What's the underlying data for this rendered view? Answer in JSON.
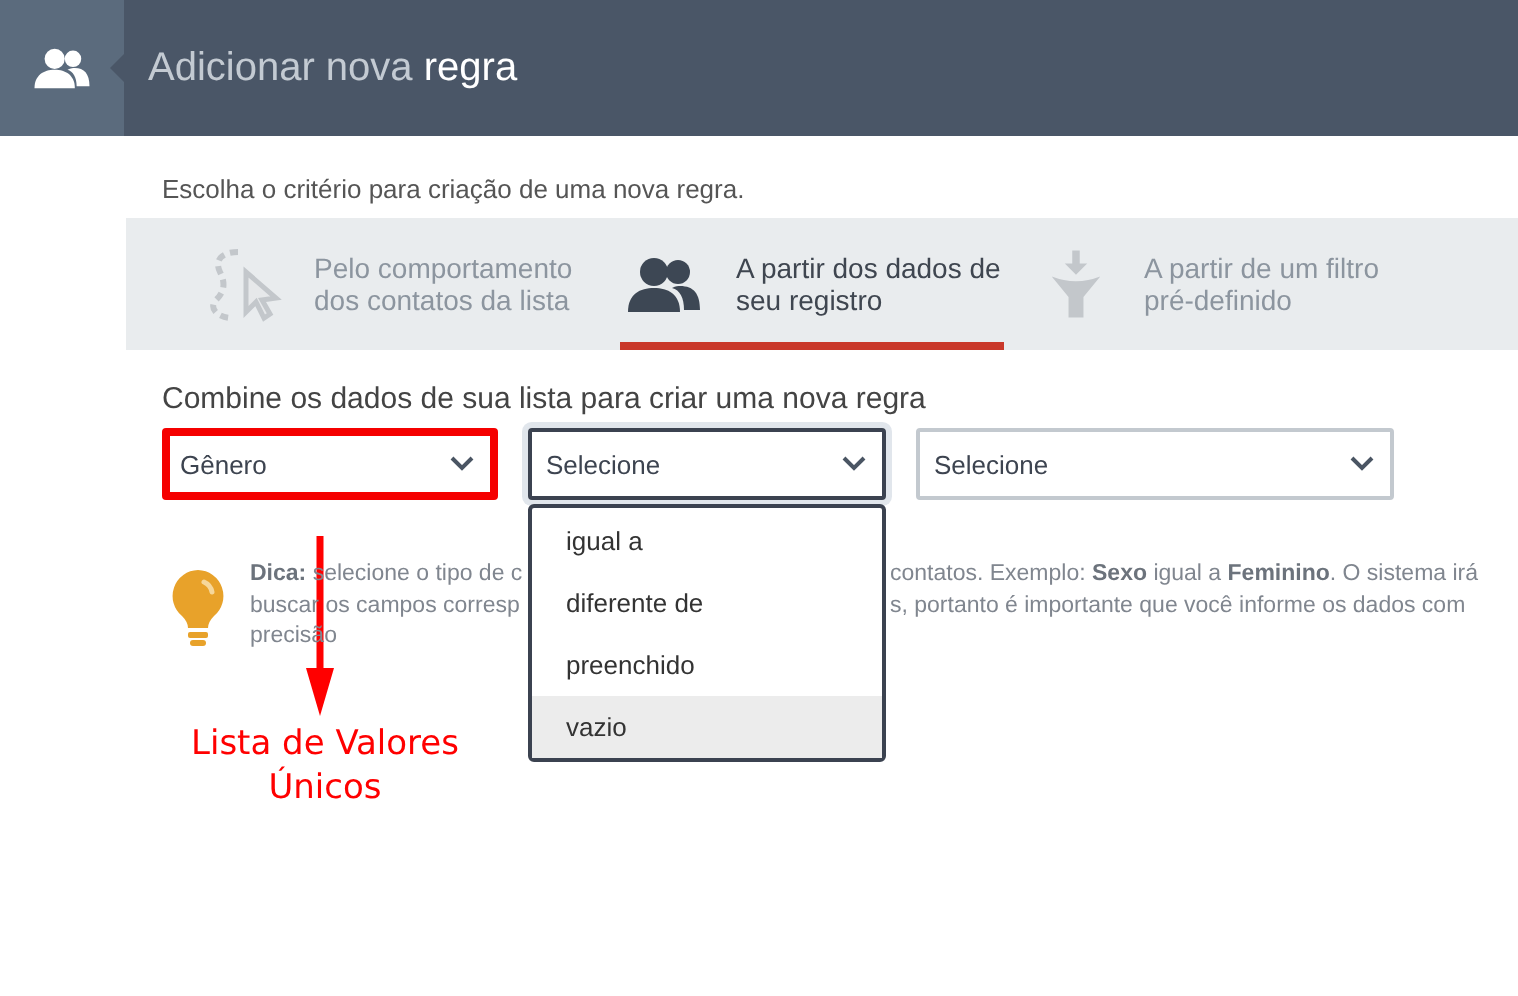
{
  "header": {
    "title": "Adicionar nova **regra**"
  },
  "intro": "Escolha o critério para criação de uma nova regra.",
  "tabs": [
    {
      "kind": "behavior",
      "label_lines": [
        "Pelo comportamento",
        "dos contatos da lista"
      ],
      "selected": false
    },
    {
      "kind": "record",
      "label_lines": [
        "A partir dos dados de",
        "seu registro"
      ],
      "selected": true
    },
    {
      "kind": "filter",
      "label_lines": [
        "A partir de um filtro",
        "pré-definido"
      ],
      "selected": false
    }
  ],
  "combine_label": "Combine os dados de sua lista para criar uma nova regra",
  "selects": [
    {
      "value": "Gênero",
      "highlighted": true,
      "focused": false
    },
    {
      "value": "Selecione",
      "highlighted": false,
      "focused": true
    },
    {
      "value": "Selecione",
      "highlighted": false,
      "focused": false
    }
  ],
  "dropdown": {
    "options": [
      {
        "label": "igual a",
        "selected": false
      },
      {
        "label": "diferente de",
        "selected": false
      },
      {
        "label": "preenchido",
        "selected": false
      },
      {
        "label": "vazio",
        "selected": true
      }
    ]
  },
  "tip": {
    "left_lines": [
      "**Dica:** selecione o tipo de c",
      "buscar os campos corresp",
      "precisão"
    ],
    "right_lines": [
      "contatos. Exemplo: **Sexo** igual a **Feminino**. O sistema irá",
      "s, portanto é importante que você informe os dados com"
    ]
  },
  "annotation": {
    "text_lines": [
      "Lista de Valores",
      "Únicos"
    ]
  }
}
